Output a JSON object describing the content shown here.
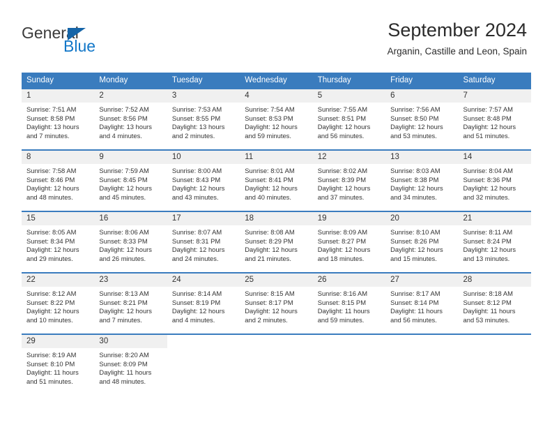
{
  "brand": {
    "name_top": "General",
    "name_bottom": "Blue",
    "triangle_color": "#1565a8",
    "blue_color": "#1277c8"
  },
  "header": {
    "title": "September 2024",
    "subtitle": "Arganin, Castille and Leon, Spain"
  },
  "theme": {
    "header_bg": "#3a7cbe",
    "daynum_bg": "#f0f0f0",
    "text": "#333333"
  },
  "weekday_headers": [
    "Sunday",
    "Monday",
    "Tuesday",
    "Wednesday",
    "Thursday",
    "Friday",
    "Saturday"
  ],
  "weeks": [
    [
      {
        "day": "1",
        "sunrise": "Sunrise: 7:51 AM",
        "sunset": "Sunset: 8:58 PM",
        "daylight_1": "Daylight: 13 hours",
        "daylight_2": "and 7 minutes."
      },
      {
        "day": "2",
        "sunrise": "Sunrise: 7:52 AM",
        "sunset": "Sunset: 8:56 PM",
        "daylight_1": "Daylight: 13 hours",
        "daylight_2": "and 4 minutes."
      },
      {
        "day": "3",
        "sunrise": "Sunrise: 7:53 AM",
        "sunset": "Sunset: 8:55 PM",
        "daylight_1": "Daylight: 13 hours",
        "daylight_2": "and 2 minutes."
      },
      {
        "day": "4",
        "sunrise": "Sunrise: 7:54 AM",
        "sunset": "Sunset: 8:53 PM",
        "daylight_1": "Daylight: 12 hours",
        "daylight_2": "and 59 minutes."
      },
      {
        "day": "5",
        "sunrise": "Sunrise: 7:55 AM",
        "sunset": "Sunset: 8:51 PM",
        "daylight_1": "Daylight: 12 hours",
        "daylight_2": "and 56 minutes."
      },
      {
        "day": "6",
        "sunrise": "Sunrise: 7:56 AM",
        "sunset": "Sunset: 8:50 PM",
        "daylight_1": "Daylight: 12 hours",
        "daylight_2": "and 53 minutes."
      },
      {
        "day": "7",
        "sunrise": "Sunrise: 7:57 AM",
        "sunset": "Sunset: 8:48 PM",
        "daylight_1": "Daylight: 12 hours",
        "daylight_2": "and 51 minutes."
      }
    ],
    [
      {
        "day": "8",
        "sunrise": "Sunrise: 7:58 AM",
        "sunset": "Sunset: 8:46 PM",
        "daylight_1": "Daylight: 12 hours",
        "daylight_2": "and 48 minutes."
      },
      {
        "day": "9",
        "sunrise": "Sunrise: 7:59 AM",
        "sunset": "Sunset: 8:45 PM",
        "daylight_1": "Daylight: 12 hours",
        "daylight_2": "and 45 minutes."
      },
      {
        "day": "10",
        "sunrise": "Sunrise: 8:00 AM",
        "sunset": "Sunset: 8:43 PM",
        "daylight_1": "Daylight: 12 hours",
        "daylight_2": "and 43 minutes."
      },
      {
        "day": "11",
        "sunrise": "Sunrise: 8:01 AM",
        "sunset": "Sunset: 8:41 PM",
        "daylight_1": "Daylight: 12 hours",
        "daylight_2": "and 40 minutes."
      },
      {
        "day": "12",
        "sunrise": "Sunrise: 8:02 AM",
        "sunset": "Sunset: 8:39 PM",
        "daylight_1": "Daylight: 12 hours",
        "daylight_2": "and 37 minutes."
      },
      {
        "day": "13",
        "sunrise": "Sunrise: 8:03 AM",
        "sunset": "Sunset: 8:38 PM",
        "daylight_1": "Daylight: 12 hours",
        "daylight_2": "and 34 minutes."
      },
      {
        "day": "14",
        "sunrise": "Sunrise: 8:04 AM",
        "sunset": "Sunset: 8:36 PM",
        "daylight_1": "Daylight: 12 hours",
        "daylight_2": "and 32 minutes."
      }
    ],
    [
      {
        "day": "15",
        "sunrise": "Sunrise: 8:05 AM",
        "sunset": "Sunset: 8:34 PM",
        "daylight_1": "Daylight: 12 hours",
        "daylight_2": "and 29 minutes."
      },
      {
        "day": "16",
        "sunrise": "Sunrise: 8:06 AM",
        "sunset": "Sunset: 8:33 PM",
        "daylight_1": "Daylight: 12 hours",
        "daylight_2": "and 26 minutes."
      },
      {
        "day": "17",
        "sunrise": "Sunrise: 8:07 AM",
        "sunset": "Sunset: 8:31 PM",
        "daylight_1": "Daylight: 12 hours",
        "daylight_2": "and 24 minutes."
      },
      {
        "day": "18",
        "sunrise": "Sunrise: 8:08 AM",
        "sunset": "Sunset: 8:29 PM",
        "daylight_1": "Daylight: 12 hours",
        "daylight_2": "and 21 minutes."
      },
      {
        "day": "19",
        "sunrise": "Sunrise: 8:09 AM",
        "sunset": "Sunset: 8:27 PM",
        "daylight_1": "Daylight: 12 hours",
        "daylight_2": "and 18 minutes."
      },
      {
        "day": "20",
        "sunrise": "Sunrise: 8:10 AM",
        "sunset": "Sunset: 8:26 PM",
        "daylight_1": "Daylight: 12 hours",
        "daylight_2": "and 15 minutes."
      },
      {
        "day": "21",
        "sunrise": "Sunrise: 8:11 AM",
        "sunset": "Sunset: 8:24 PM",
        "daylight_1": "Daylight: 12 hours",
        "daylight_2": "and 13 minutes."
      }
    ],
    [
      {
        "day": "22",
        "sunrise": "Sunrise: 8:12 AM",
        "sunset": "Sunset: 8:22 PM",
        "daylight_1": "Daylight: 12 hours",
        "daylight_2": "and 10 minutes."
      },
      {
        "day": "23",
        "sunrise": "Sunrise: 8:13 AM",
        "sunset": "Sunset: 8:21 PM",
        "daylight_1": "Daylight: 12 hours",
        "daylight_2": "and 7 minutes."
      },
      {
        "day": "24",
        "sunrise": "Sunrise: 8:14 AM",
        "sunset": "Sunset: 8:19 PM",
        "daylight_1": "Daylight: 12 hours",
        "daylight_2": "and 4 minutes."
      },
      {
        "day": "25",
        "sunrise": "Sunrise: 8:15 AM",
        "sunset": "Sunset: 8:17 PM",
        "daylight_1": "Daylight: 12 hours",
        "daylight_2": "and 2 minutes."
      },
      {
        "day": "26",
        "sunrise": "Sunrise: 8:16 AM",
        "sunset": "Sunset: 8:15 PM",
        "daylight_1": "Daylight: 11 hours",
        "daylight_2": "and 59 minutes."
      },
      {
        "day": "27",
        "sunrise": "Sunrise: 8:17 AM",
        "sunset": "Sunset: 8:14 PM",
        "daylight_1": "Daylight: 11 hours",
        "daylight_2": "and 56 minutes."
      },
      {
        "day": "28",
        "sunrise": "Sunrise: 8:18 AM",
        "sunset": "Sunset: 8:12 PM",
        "daylight_1": "Daylight: 11 hours",
        "daylight_2": "and 53 minutes."
      }
    ],
    [
      {
        "day": "29",
        "sunrise": "Sunrise: 8:19 AM",
        "sunset": "Sunset: 8:10 PM",
        "daylight_1": "Daylight: 11 hours",
        "daylight_2": "and 51 minutes."
      },
      {
        "day": "30",
        "sunrise": "Sunrise: 8:20 AM",
        "sunset": "Sunset: 8:09 PM",
        "daylight_1": "Daylight: 11 hours",
        "daylight_2": "and 48 minutes."
      },
      null,
      null,
      null,
      null,
      null
    ]
  ]
}
